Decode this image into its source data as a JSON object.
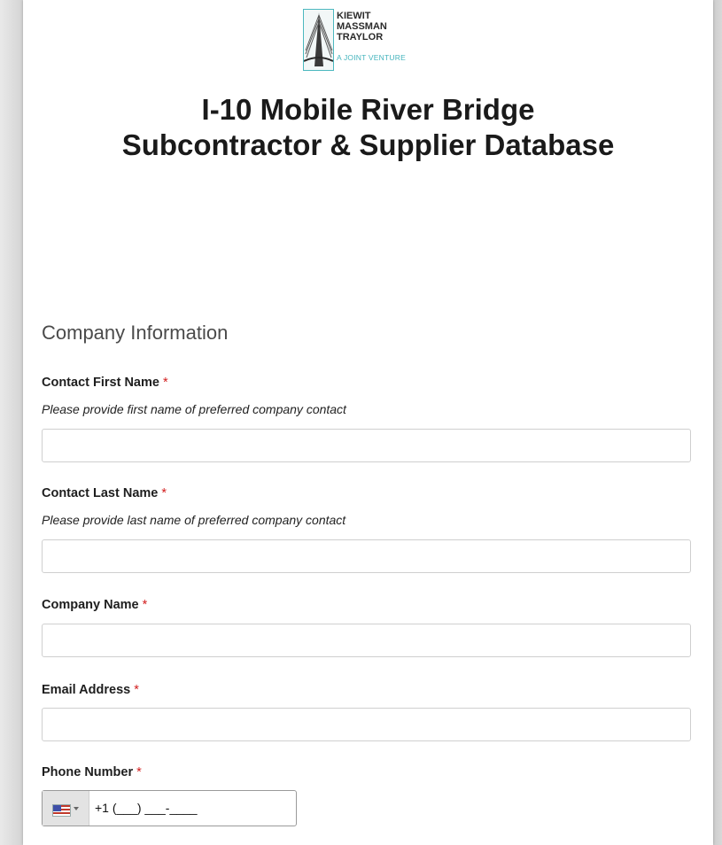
{
  "logo": {
    "lines": [
      "KIEWIT",
      "MASSMAN",
      "TRAYLOR"
    ],
    "tagline": "A JOINT VENTURE"
  },
  "title": {
    "line1": "I-10 Mobile River Bridge",
    "line2": "Subcontractor & Supplier Database"
  },
  "section": "Company Information",
  "required_mark": "*",
  "fields": {
    "first_name": {
      "label": "Contact First Name",
      "help": "Please provide first name of preferred company contact",
      "value": ""
    },
    "last_name": {
      "label": "Contact Last Name",
      "help": "Please provide last name of preferred company contact",
      "value": ""
    },
    "company": {
      "label": "Company Name",
      "value": ""
    },
    "email": {
      "label": "Email Address",
      "value": ""
    },
    "phone": {
      "label": "Phone Number",
      "country_icon": "us-flag-icon",
      "value": "+1 (___) ___-____"
    }
  },
  "colors": {
    "required": "#d21e1e",
    "logo_accent": "#45b4bd",
    "background": "#cfcfcf"
  }
}
